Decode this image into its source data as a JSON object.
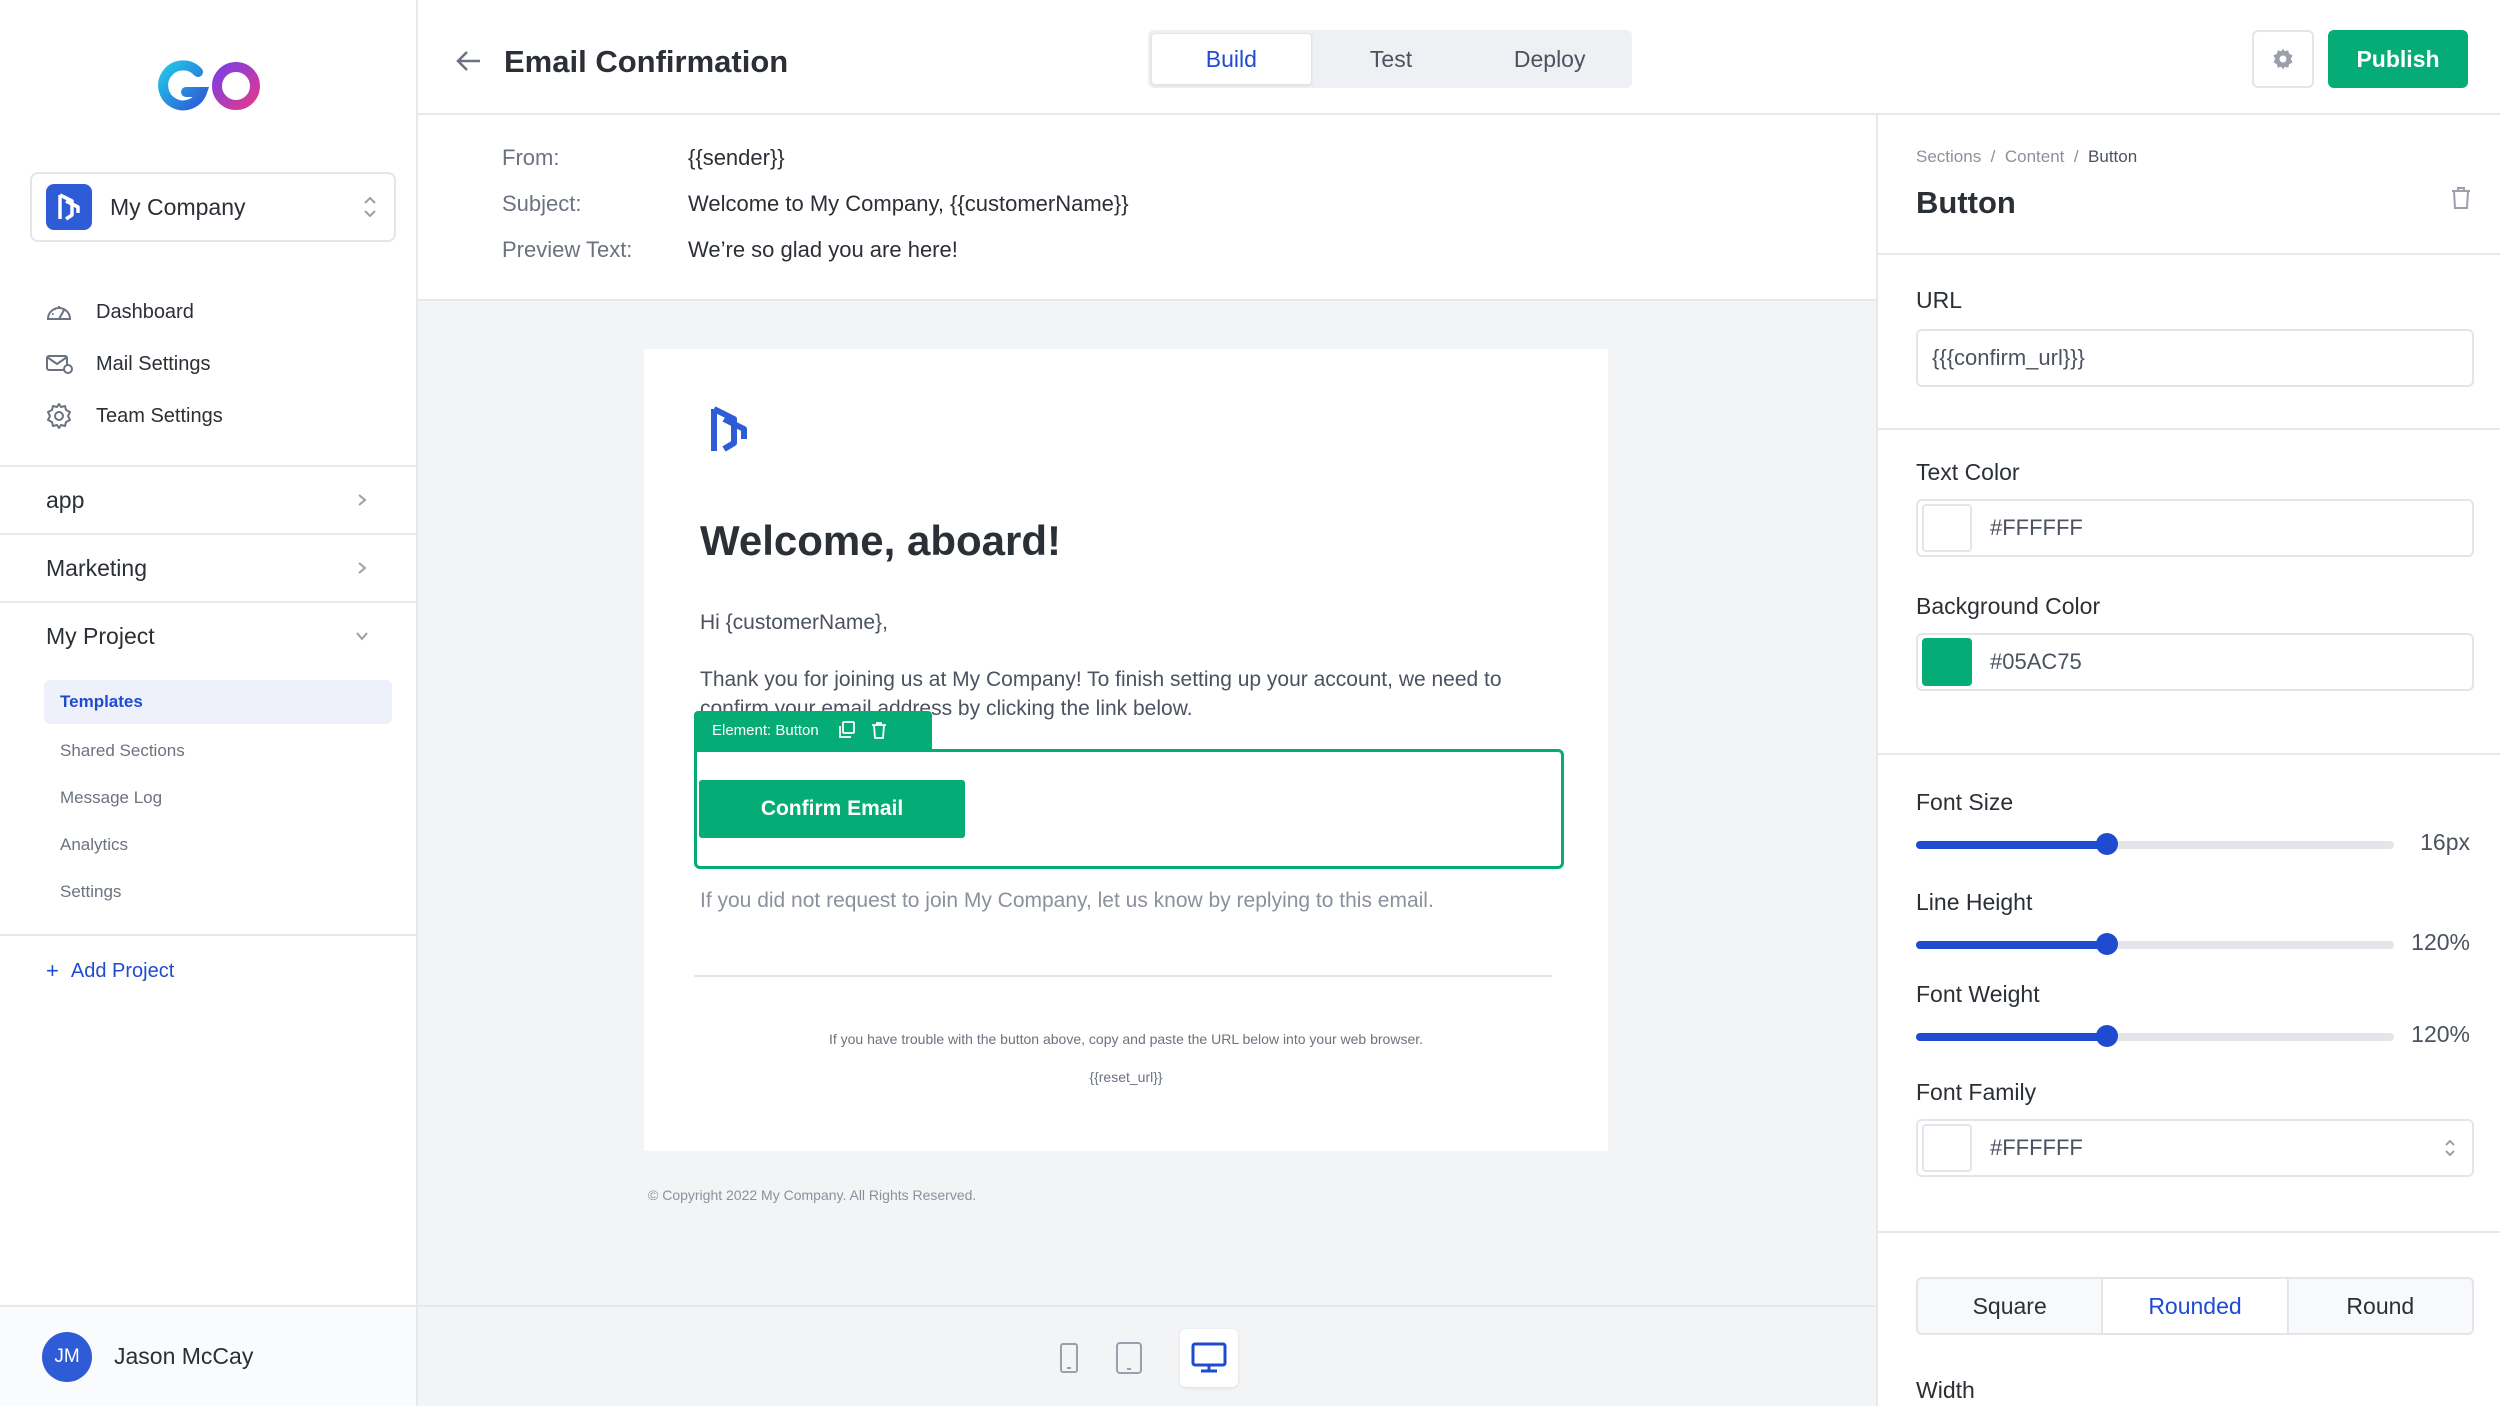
{
  "app": {
    "title": "Email Confirmation"
  },
  "sidebar": {
    "company": "My Company",
    "nav": [
      {
        "label": "Dashboard",
        "icon": "dashboard-icon"
      },
      {
        "label": "Mail Settings",
        "icon": "mail-settings-icon"
      },
      {
        "label": "Team Settings",
        "icon": "gear-icon"
      }
    ],
    "sections": [
      "app",
      "Marketing",
      "My Project"
    ],
    "sub_items": [
      "Templates",
      "Shared Sections",
      "Message Log",
      "Analytics",
      "Settings"
    ],
    "active_sub": "Templates",
    "add_project": "Add Project",
    "user": {
      "initials": "JM",
      "name": "Jason McCay"
    }
  },
  "header": {
    "tabs": [
      "Build",
      "Test",
      "Deploy"
    ],
    "active_tab": "Build",
    "publish_label": "Publish"
  },
  "meta": {
    "from_label": "From:",
    "from_value": "{{sender}}",
    "subject_label": "Subject:",
    "subject_value": "Welcome to My Company, {{customerName}}",
    "preview_label": "Preview Text:",
    "preview_value": "We’re so glad you are here!"
  },
  "email": {
    "heading": "Welcome, aboard!",
    "greeting": "Hi {customerName},",
    "body": "Thank you for joining us at My Company! To finish setting up your account, we need to confirm your email address by clicking the link below.",
    "element_tag": "Element: Button",
    "button_label": "Confirm Email",
    "disclaimer": "If you did not request to join My Company, let us know by replying to this email.",
    "trouble": "If you have trouble with the button above, copy and paste the URL below into your web browser.",
    "reset_url": "{{reset_url}}",
    "copyright": "© Copyright 2022 My Company. All Rights Reserved."
  },
  "panel": {
    "breadcrumbs": [
      "Sections",
      "Content",
      "Button"
    ],
    "title": "Button",
    "url_label": "URL",
    "url_value": "{{{confirm_url}}}",
    "text_color_label": "Text Color",
    "text_color_value": "#FFFFFF",
    "bg_color_label": "Background Color",
    "bg_color_value": "#05AC75",
    "font_size_label": "Font Size",
    "font_size_value": "16px",
    "font_size_fraction": 0.4,
    "line_height_label": "Line Height",
    "line_height_value": "120%",
    "line_height_fraction": 0.4,
    "font_weight_label": "Font Weight",
    "font_weight_value": "120%",
    "font_weight_fraction": 0.4,
    "font_family_label": "Font Family",
    "font_family_value": "#FFFFFF",
    "shapes": [
      "Square",
      "Rounded",
      "Round"
    ],
    "active_shape": "Rounded",
    "width_label": "Width"
  },
  "colors": {
    "accent": "#1F4BD1",
    "brand_green": "#05AC75"
  }
}
